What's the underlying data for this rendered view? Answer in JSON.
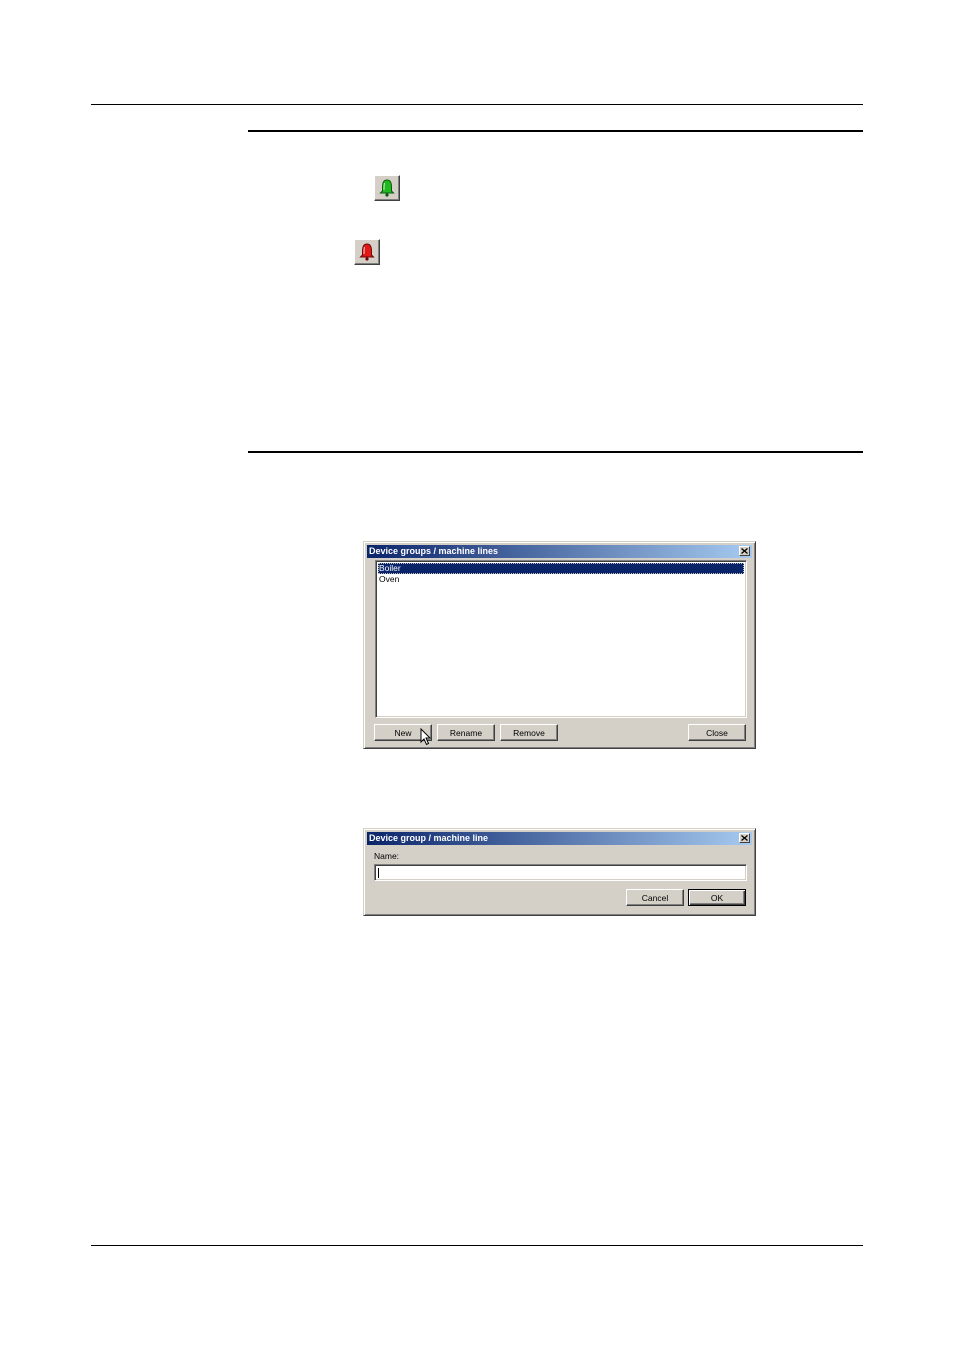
{
  "toolbar_icons": [
    {
      "name": "green-bell-icon",
      "color": "#22b822"
    },
    {
      "name": "red-bell-icon",
      "color": "#e01818"
    }
  ],
  "device_groups_dialog": {
    "title": "Device groups / machine lines",
    "items": [
      {
        "label": "Boiler",
        "selected": true
      },
      {
        "label": "Oven",
        "selected": false
      }
    ],
    "buttons": {
      "new": "New",
      "rename": "Rename",
      "remove": "Remove",
      "close": "Close"
    }
  },
  "device_group_dialog": {
    "title": "Device group / machine line",
    "name_label": "Name:",
    "name_value": "",
    "buttons": {
      "cancel": "Cancel",
      "ok": "OK"
    }
  },
  "colors": {
    "titlebar_start": "#0a246a",
    "titlebar_end": "#a6caf0",
    "face": "#d4d0c8",
    "selection": "#0a246a"
  }
}
